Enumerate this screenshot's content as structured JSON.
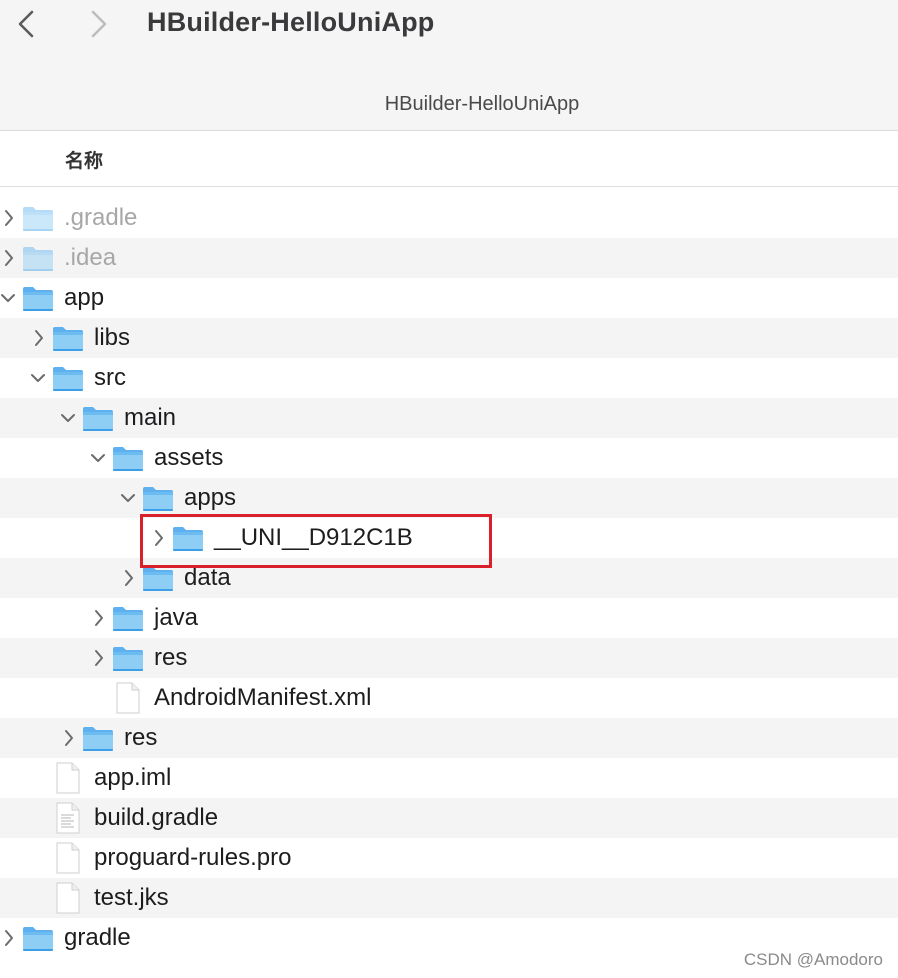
{
  "window": {
    "title": "HBuilder-HelloUniApp",
    "path_title": "HBuilder-HelloUniApp"
  },
  "header": {
    "name_column": "名称"
  },
  "rows": [
    {
      "label": ".gradle",
      "type": "folder",
      "depth": 0,
      "expander": "collapsed",
      "dim": true
    },
    {
      "label": ".idea",
      "type": "folder",
      "depth": 0,
      "expander": "collapsed",
      "dim": true
    },
    {
      "label": "app",
      "type": "folder",
      "depth": 0,
      "expander": "expanded"
    },
    {
      "label": "libs",
      "type": "folder",
      "depth": 1,
      "expander": "collapsed"
    },
    {
      "label": "src",
      "type": "folder",
      "depth": 1,
      "expander": "expanded"
    },
    {
      "label": "main",
      "type": "folder",
      "depth": 2,
      "expander": "expanded"
    },
    {
      "label": "assets",
      "type": "folder",
      "depth": 3,
      "expander": "expanded"
    },
    {
      "label": "apps",
      "type": "folder",
      "depth": 4,
      "expander": "expanded"
    },
    {
      "label": "__UNI__D912C1B",
      "type": "folder",
      "depth": 5,
      "expander": "collapsed",
      "highlighted": true
    },
    {
      "label": "data",
      "type": "folder",
      "depth": 4,
      "expander": "collapsed"
    },
    {
      "label": "java",
      "type": "folder",
      "depth": 3,
      "expander": "collapsed"
    },
    {
      "label": "res",
      "type": "folder",
      "depth": 3,
      "expander": "collapsed"
    },
    {
      "label": "AndroidManifest.xml",
      "type": "file",
      "depth": 3,
      "expander": "none"
    },
    {
      "label": "res",
      "type": "folder",
      "depth": 2,
      "expander": "collapsed"
    },
    {
      "label": "app.iml",
      "type": "file",
      "depth": 1,
      "expander": "none"
    },
    {
      "label": "build.gradle",
      "type": "textfile",
      "depth": 1,
      "expander": "none"
    },
    {
      "label": "proguard-rules.pro",
      "type": "file",
      "depth": 1,
      "expander": "none"
    },
    {
      "label": "test.jks",
      "type": "file",
      "depth": 1,
      "expander": "none"
    },
    {
      "label": "gradle",
      "type": "folder",
      "depth": 0,
      "expander": "collapsed"
    }
  ],
  "icons": {
    "back": "chevron-left-icon",
    "forward": "chevron-right-icon",
    "folder": "folder-icon",
    "file": "document-icon"
  },
  "colors": {
    "highlight": "#d9202b",
    "folder_light": "#8ecdf4",
    "folder_dark": "#3d9ee8",
    "stripe": "#f4f4f4"
  },
  "watermark": "CSDN @Amodoro"
}
